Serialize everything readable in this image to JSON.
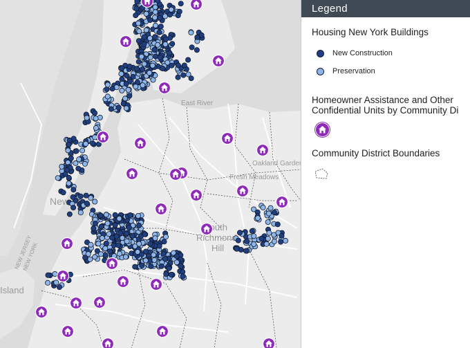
{
  "legend": {
    "header": "Legend",
    "sections": [
      {
        "title": "Housing New York Buildings",
        "items": [
          {
            "label": "New Construction",
            "color": "#1f3f80"
          },
          {
            "label": "Preservation",
            "color": "#8fb6ea"
          }
        ]
      },
      {
        "title_line1": "Homeowner Assistance and Other",
        "title_line2": "Confidential Units by Community Di",
        "symbol": "house-icon",
        "color": "#8e2ab8"
      },
      {
        "title": "Community District Boundaries",
        "symbol": "dashed-polygon"
      }
    ]
  },
  "map": {
    "labels": {
      "east_river": "East River",
      "oakland_gardens": "Oakland Gardens",
      "fresh_meadows": "Fresh Meadows",
      "new_york": "New",
      "south_richmond_hill_1": "South",
      "south_richmond_hill_2": "Richmond",
      "south_richmond_hill_3": "Hill",
      "new_jersey": "NEW JERSEY",
      "new_york_state": "NEW YORK",
      "island": "Island"
    },
    "colors": {
      "water": "#dcdcdc",
      "land": "#ececec",
      "new_construction": "#1f3f80",
      "preservation": "#8fb6ea",
      "homeowner": "#8e2ab8"
    }
  }
}
